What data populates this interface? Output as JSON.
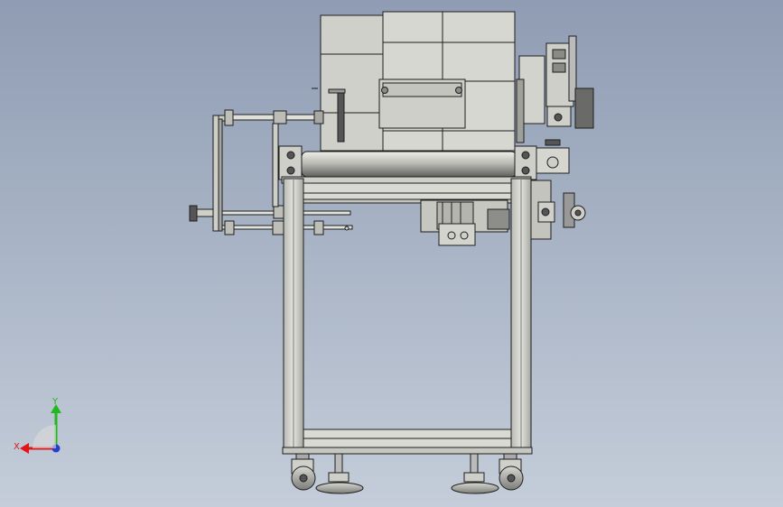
{
  "viewport": {
    "background_top": "#8f9cb3",
    "background_bottom": "#c4cdd9"
  },
  "model": {
    "body_fill": "#d4d4cf",
    "dark_fill": "#6e6e6e",
    "stroke": "#1e1e1e"
  },
  "triad": {
    "x_label": "X",
    "y_label": "Y",
    "x_color": "#e0161b",
    "y_color": "#22b81e",
    "z_color": "#2a3ccc"
  }
}
